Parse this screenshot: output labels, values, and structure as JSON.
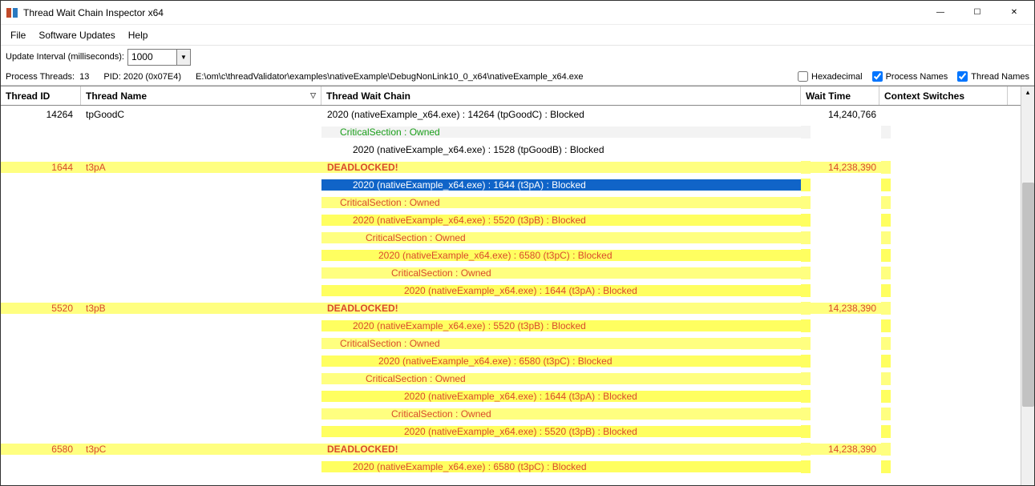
{
  "window": {
    "title": "Thread Wait Chain Inspector x64"
  },
  "menu": {
    "file": "File",
    "updates": "Software Updates",
    "help": "Help"
  },
  "toolbar": {
    "interval_label": "Update Interval (milliseconds):",
    "interval_value": "1000"
  },
  "info": {
    "threads_label": "Process Threads:",
    "threads_count": "13",
    "pid_label": "PID:",
    "pid_value": "2020 (0x07E4)",
    "path": "E:\\om\\c\\threadValidator\\examples\\nativeExample\\DebugNonLink10_0_x64\\nativeExample_x64.exe",
    "cb_hex": "Hexadecimal",
    "cb_proc": "Process Names",
    "cb_thread": "Thread Names"
  },
  "columns": {
    "tid": "Thread ID",
    "tname": "Thread Name",
    "chain": "Thread Wait Chain",
    "wait": "Wait Time",
    "ctx": "Context Switches"
  },
  "rows": [
    {
      "tid": "14264",
      "tname": "tpGoodC",
      "chain": "2020 (nativeExample_x64.exe) : 14264 (tpGoodC) : Blocked",
      "wait": "14,240,766",
      "indent": 0,
      "style": "normal",
      "kind": "blocked"
    },
    {
      "chain": "CriticalSection : Owned",
      "indent": 1,
      "style": "normal-alt",
      "kind": "cs"
    },
    {
      "chain": "2020 (nativeExample_x64.exe) : 1528 (tpGoodB) : Blocked",
      "indent": 2,
      "style": "normal",
      "kind": "blocked"
    },
    {
      "tid": "1644",
      "tname": "t3pA",
      "chain": "DEADLOCKED!",
      "wait": "14,238,390",
      "indent": 0,
      "style": "dl-bg",
      "kind": "dlhead"
    },
    {
      "chain": "2020 (nativeExample_x64.exe) : 1644 (t3pA) : Blocked",
      "indent": 2,
      "style": "dl-bg-alt",
      "kind": "dl",
      "selected": true
    },
    {
      "chain": "CriticalSection : Owned",
      "indent": 1,
      "style": "dl-bg",
      "kind": "dlcs"
    },
    {
      "chain": "2020 (nativeExample_x64.exe) : 5520 (t3pB) : Blocked",
      "indent": 2,
      "style": "dl-bg-alt",
      "kind": "dl"
    },
    {
      "chain": "CriticalSection : Owned",
      "indent": 3,
      "style": "dl-bg",
      "kind": "dlcs"
    },
    {
      "chain": "2020 (nativeExample_x64.exe) : 6580 (t3pC) : Blocked",
      "indent": 4,
      "style": "dl-bg-alt",
      "kind": "dl"
    },
    {
      "chain": "CriticalSection : Owned",
      "indent": 5,
      "style": "dl-bg",
      "kind": "dlcs"
    },
    {
      "chain": "2020 (nativeExample_x64.exe) : 1644 (t3pA) : Blocked",
      "indent": 6,
      "style": "dl-bg-alt",
      "kind": "dl"
    },
    {
      "tid": "5520",
      "tname": "t3pB",
      "chain": "DEADLOCKED!",
      "wait": "14,238,390",
      "indent": 0,
      "style": "dl-bg",
      "kind": "dlhead"
    },
    {
      "chain": "2020 (nativeExample_x64.exe) : 5520 (t3pB) : Blocked",
      "indent": 2,
      "style": "dl-bg-alt",
      "kind": "dl"
    },
    {
      "chain": "CriticalSection : Owned",
      "indent": 1,
      "style": "dl-bg",
      "kind": "dlcs"
    },
    {
      "chain": "2020 (nativeExample_x64.exe) : 6580 (t3pC) : Blocked",
      "indent": 4,
      "style": "dl-bg-alt",
      "kind": "dl"
    },
    {
      "chain": "CriticalSection : Owned",
      "indent": 3,
      "style": "dl-bg",
      "kind": "dlcs"
    },
    {
      "chain": "2020 (nativeExample_x64.exe) : 1644 (t3pA) : Blocked",
      "indent": 6,
      "style": "dl-bg-alt",
      "kind": "dl"
    },
    {
      "chain": "CriticalSection : Owned",
      "indent": 5,
      "style": "dl-bg",
      "kind": "dlcs"
    },
    {
      "chain": "2020 (nativeExample_x64.exe) : 5520 (t3pB) : Blocked",
      "indent": 6,
      "style": "dl-bg-alt",
      "kind": "dl"
    },
    {
      "tid": "6580",
      "tname": "t3pC",
      "chain": "DEADLOCKED!",
      "wait": "14,238,390",
      "indent": 0,
      "style": "dl-bg",
      "kind": "dlhead"
    },
    {
      "chain": "2020 (nativeExample_x64.exe) : 6580 (t3pC) : Blocked",
      "indent": 2,
      "style": "dl-bg-alt",
      "kind": "dl"
    }
  ]
}
